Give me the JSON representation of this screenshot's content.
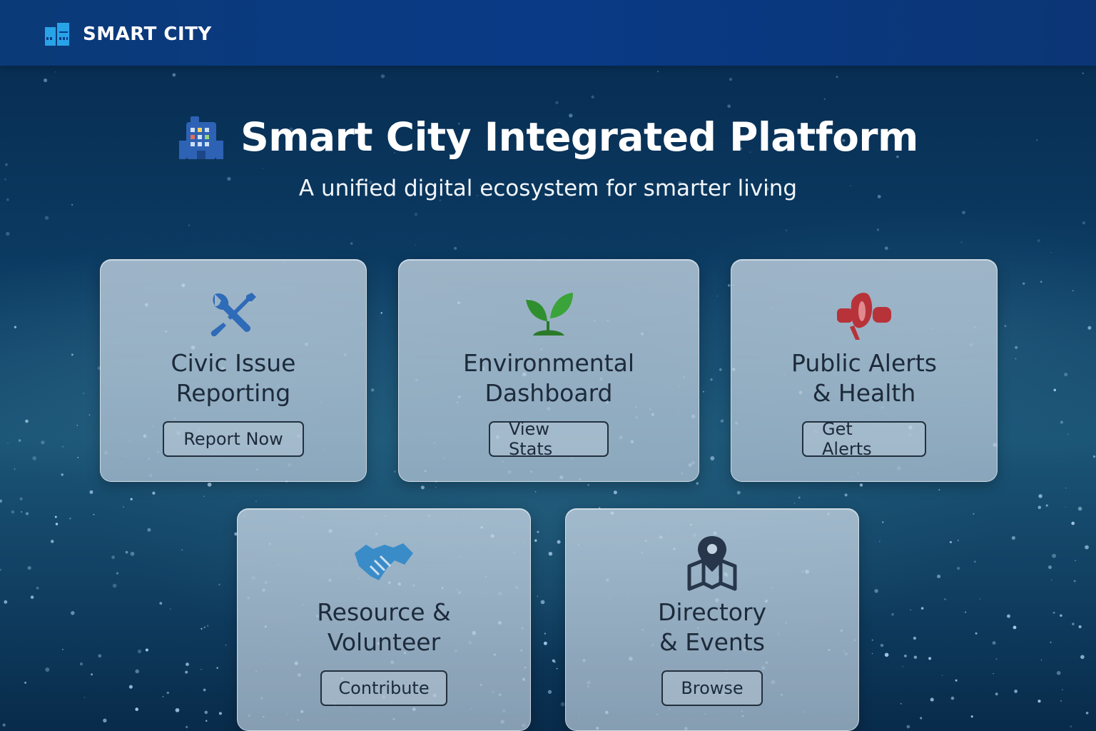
{
  "header": {
    "brand": "SMART CITY",
    "logo_icon": "building-grid-icon",
    "bar_color": "#0a3a86"
  },
  "hero": {
    "title": "Smart City Integrated Platform",
    "subtitle": "A unified digital ecosystem for smarter living",
    "icon": "city-building-icon"
  },
  "cards": [
    {
      "title": "Civic Issue\nReporting",
      "button": "Report Now",
      "icon": "wrench-screwdriver-icon",
      "icon_color": "#2e6bb8"
    },
    {
      "title": "Environmental\nDashboard",
      "button": "View Stats",
      "icon": "sprout-icon",
      "icon_color": "#2f8f2f"
    },
    {
      "title": "Public Alerts\n& Health",
      "button": "Get Alerts",
      "icon": "megaphone-icon",
      "icon_color": "#b8323a"
    },
    {
      "title": "Resource &\nVolunteer",
      "button": "Contribute",
      "icon": "handshake-icon",
      "icon_color": "#3a8cc8"
    },
    {
      "title": "Directory\n& Events",
      "button": "Browse",
      "icon": "map-pin-icon",
      "icon_color": "#27364a"
    }
  ]
}
